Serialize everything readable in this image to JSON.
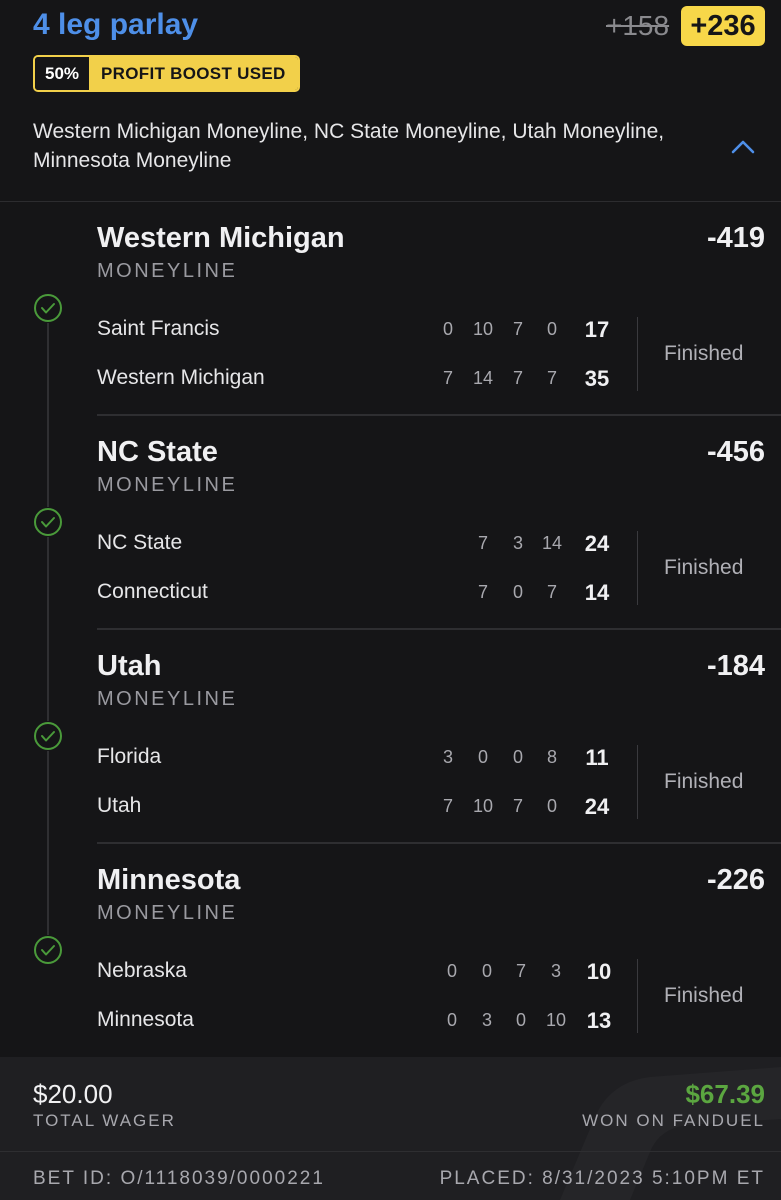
{
  "header": {
    "title": "4 leg parlay",
    "old_odds": "+158",
    "new_odds": "+236",
    "boost_pct": "50%",
    "boost_label": "PROFIT BOOST USED",
    "summary": "Western Michigan Moneyline, NC State Moneyline, Utah Moneyline, Minnesota Moneyline"
  },
  "legs": [
    {
      "name": "Western Michigan",
      "type": "MONEYLINE",
      "odds": "-419",
      "status": "Finished",
      "teams": [
        {
          "name": "Saint Francis",
          "quarters": [
            "0",
            "10",
            "7",
            "0"
          ],
          "total": "17"
        },
        {
          "name": "Western Michigan",
          "quarters": [
            "7",
            "14",
            "7",
            "7"
          ],
          "total": "35"
        }
      ]
    },
    {
      "name": "NC State",
      "type": "MONEYLINE",
      "odds": "-456",
      "status": "Finished",
      "teams": [
        {
          "name": "NC State",
          "quarters": [
            "7",
            "3",
            "14"
          ],
          "total": "24"
        },
        {
          "name": "Connecticut",
          "quarters": [
            "7",
            "0",
            "7"
          ],
          "total": "14"
        }
      ]
    },
    {
      "name": "Utah",
      "type": "MONEYLINE",
      "odds": "-184",
      "status": "Finished",
      "teams": [
        {
          "name": "Florida",
          "quarters": [
            "3",
            "0",
            "0",
            "8"
          ],
          "total": "11"
        },
        {
          "name": "Utah",
          "quarters": [
            "7",
            "10",
            "7",
            "0"
          ],
          "total": "24"
        }
      ]
    },
    {
      "name": "Minnesota",
      "type": "MONEYLINE",
      "odds": "-226",
      "status": "Finished",
      "teams": [
        {
          "name": "Nebraska",
          "quarters": [
            "0",
            "0",
            "7",
            "3"
          ],
          "total": "10"
        },
        {
          "name": "Minnesota",
          "quarters": [
            "0",
            "3",
            "0",
            "10"
          ],
          "total": "13"
        }
      ]
    }
  ],
  "footer": {
    "wager": "$20.00",
    "wager_label": "TOTAL WAGER",
    "won": "$67.39",
    "won_label": "WON ON FANDUEL",
    "bet_id": "BET ID: O/1118039/0000221",
    "placed": "PLACED: 8/31/2023 5:10PM ET"
  },
  "colors": {
    "background": "#151517",
    "accent_blue": "#4e8fe8",
    "boost_yellow": "#f2d04a",
    "win_green": "#5ba640",
    "check_green": "#4a9a3a"
  },
  "icons": {
    "expand": "chevron-up-icon",
    "leg_status": "check-circle-icon"
  }
}
